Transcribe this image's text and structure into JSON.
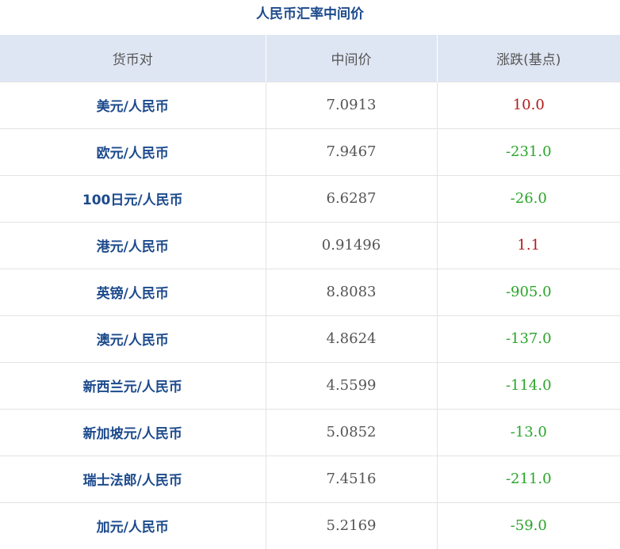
{
  "title": "人民币汇率中间价",
  "headers": [
    "货币对",
    "中间价",
    "涨跌(基点)"
  ],
  "colors": {
    "title": "#1c4a8c",
    "header_bg": "#dfe6f3",
    "up": "#b41a1a",
    "down": "#2aa52a"
  },
  "rows": [
    {
      "pair": "美元/人民币",
      "mid": "7.0913",
      "change": "10.0",
      "dir": "up"
    },
    {
      "pair": "欧元/人民币",
      "mid": "7.9467",
      "change": "-231.0",
      "dir": "down"
    },
    {
      "pair": "100日元/人民币",
      "mid": "6.6287",
      "change": "-26.0",
      "dir": "down"
    },
    {
      "pair": "港元/人民币",
      "mid": "0.91496",
      "change": "1.1",
      "dir": "up"
    },
    {
      "pair": "英镑/人民币",
      "mid": "8.8083",
      "change": "-905.0",
      "dir": "down"
    },
    {
      "pair": "澳元/人民币",
      "mid": "4.8624",
      "change": "-137.0",
      "dir": "down"
    },
    {
      "pair": "新西兰元/人民币",
      "mid": "4.5599",
      "change": "-114.0",
      "dir": "down"
    },
    {
      "pair": "新加坡元/人民币",
      "mid": "5.0852",
      "change": "-13.0",
      "dir": "down"
    },
    {
      "pair": "瑞士法郎/人民币",
      "mid": "7.4516",
      "change": "-211.0",
      "dir": "down"
    },
    {
      "pair": "加元/人民币",
      "mid": "5.2169",
      "change": "-59.0",
      "dir": "down"
    }
  ]
}
